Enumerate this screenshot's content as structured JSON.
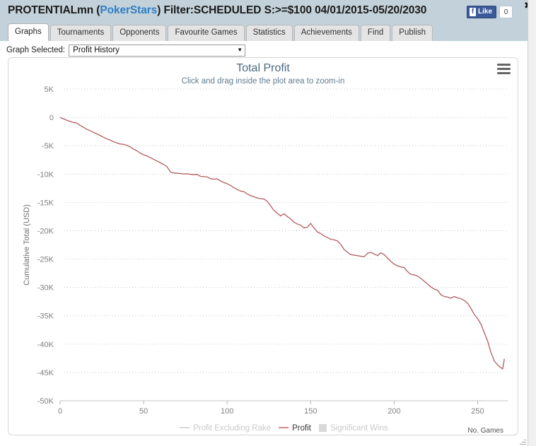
{
  "window": {
    "title_prefix": "PROTENTIALmn (",
    "title_site": "PokerStars",
    "title_suffix": ") Filter:SCHEDULED S:>=$100 04/01/2015-05/20/2030",
    "close_label": "✖"
  },
  "social": {
    "fb_icon_letter": "f",
    "like_label": "Like",
    "like_count": "0"
  },
  "tabs": [
    {
      "label": "Graphs",
      "active": true
    },
    {
      "label": "Tournaments",
      "active": false
    },
    {
      "label": "Opponents",
      "active": false
    },
    {
      "label": "Favourite Games",
      "active": false
    },
    {
      "label": "Statistics",
      "active": false
    },
    {
      "label": "Achievements",
      "active": false
    },
    {
      "label": "Find",
      "active": false
    },
    {
      "label": "Publish",
      "active": false
    }
  ],
  "selector": {
    "label": "Graph Selected:",
    "value": "Profit History",
    "arrow": "▼"
  },
  "chart_data": {
    "type": "line",
    "title": "Total Profit",
    "subtitle": "Click and drag inside the plot area to zoom-in",
    "xlabel": "No. Games",
    "ylabel": "Cumulative Total (USD)",
    "xlim": [
      0,
      268
    ],
    "ylim": [
      -50000,
      5000
    ],
    "grid": true,
    "legend_position": "bottom",
    "y_ticks": [
      5000,
      0,
      -5000,
      -10000,
      -15000,
      -20000,
      -25000,
      -30000,
      -35000,
      -40000,
      -45000,
      -50000
    ],
    "y_tick_labels": [
      "5K",
      "0",
      "-5K",
      "-10K",
      "-15K",
      "-20K",
      "-25K",
      "-30K",
      "-35K",
      "-40K",
      "-45K",
      "-50K"
    ],
    "x_ticks": [
      0,
      50,
      100,
      150,
      200,
      250
    ],
    "x_tick_labels": [
      "0",
      "50",
      "100",
      "150",
      "200",
      "250"
    ],
    "legend": [
      {
        "name": "Profit Excluding Rake",
        "color": "#d8d8d8",
        "marker": "line",
        "enabled": false
      },
      {
        "name": "Profit",
        "color": "#d08a8a",
        "marker": "line",
        "enabled": true
      },
      {
        "name": "Significant Wins",
        "color": "#d8d8d8",
        "marker": "square",
        "enabled": false
      }
    ],
    "series": [
      {
        "name": "Profit",
        "color": "#b25b60",
        "x": [
          0,
          2,
          4,
          6,
          8,
          10,
          12,
          14,
          16,
          18,
          20,
          22,
          24,
          26,
          28,
          30,
          32,
          34,
          36,
          38,
          40,
          42,
          44,
          46,
          48,
          50,
          52,
          54,
          56,
          58,
          60,
          62,
          64,
          66,
          68,
          70,
          72,
          74,
          76,
          78,
          80,
          82,
          84,
          86,
          88,
          90,
          92,
          94,
          96,
          98,
          100,
          102,
          104,
          106,
          108,
          110,
          112,
          114,
          116,
          118,
          120,
          122,
          124,
          126,
          128,
          130,
          132,
          134,
          136,
          138,
          140,
          142,
          144,
          146,
          148,
          150,
          152,
          154,
          156,
          158,
          160,
          162,
          164,
          166,
          168,
          170,
          172,
          174,
          176,
          178,
          180,
          182,
          184,
          186,
          188,
          190,
          192,
          194,
          196,
          198,
          200,
          202,
          204,
          206,
          208,
          210,
          212,
          214,
          216,
          218,
          220,
          222,
          224,
          226,
          228,
          230,
          232,
          234,
          236,
          238,
          240,
          242,
          244,
          246,
          248,
          250,
          252,
          254,
          256,
          258,
          260,
          262,
          264,
          265,
          266
        ],
        "y": [
          0,
          -250,
          -500,
          -700,
          -900,
          -1000,
          -1400,
          -1750,
          -2100,
          -2350,
          -2650,
          -2900,
          -3200,
          -3500,
          -3800,
          -4000,
          -4300,
          -4500,
          -4700,
          -4750,
          -4950,
          -5200,
          -5600,
          -5900,
          -6300,
          -6600,
          -6800,
          -7100,
          -7400,
          -7700,
          -8000,
          -8300,
          -8700,
          -9600,
          -9800,
          -9850,
          -9900,
          -10000,
          -9950,
          -10050,
          -10100,
          -10050,
          -10400,
          -10450,
          -10500,
          -10800,
          -10900,
          -10850,
          -11200,
          -11500,
          -11700,
          -12000,
          -12400,
          -12700,
          -13000,
          -13100,
          -13500,
          -13800,
          -14000,
          -14200,
          -14350,
          -14400,
          -14800,
          -15600,
          -16400,
          -16900,
          -17400,
          -17000,
          -17500,
          -17900,
          -18500,
          -18800,
          -19000,
          -19500,
          -19400,
          -18700,
          -19500,
          -20200,
          -20500,
          -20900,
          -21200,
          -21500,
          -21600,
          -21800,
          -22400,
          -23300,
          -23800,
          -24200,
          -24300,
          -24400,
          -24500,
          -24600,
          -24000,
          -23800,
          -24100,
          -24400,
          -23900,
          -24200,
          -24800,
          -25400,
          -25900,
          -26200,
          -26400,
          -26500,
          -27200,
          -27700,
          -27800,
          -28000,
          -28400,
          -28900,
          -29400,
          -29900,
          -30300,
          -30500,
          -31300,
          -31600,
          -31700,
          -31900,
          -31600,
          -31850,
          -32000,
          -32300,
          -32800,
          -33700,
          -34800,
          -35500,
          -36500,
          -38000,
          -39500,
          -41500,
          -43000,
          -43700,
          -44200,
          -44400,
          -42600
        ]
      }
    ]
  }
}
